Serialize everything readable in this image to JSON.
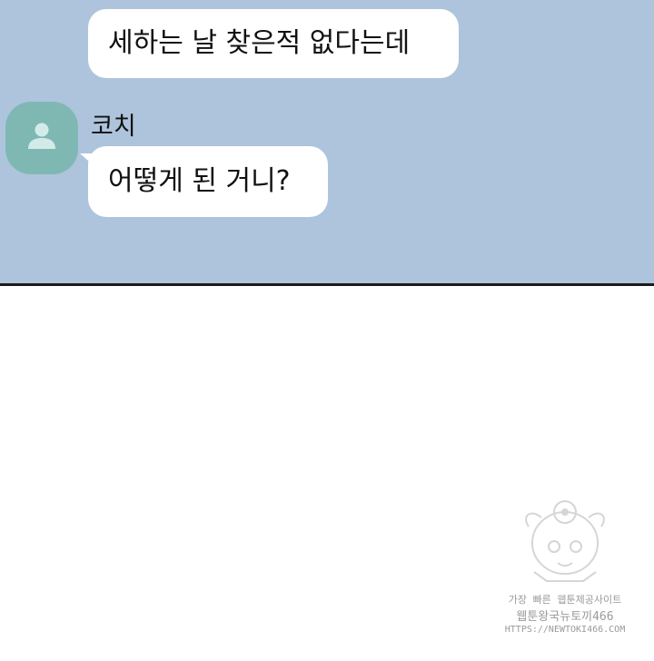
{
  "chat": {
    "messages": [
      {
        "text": "세하는 날 찾은적 없다는데"
      },
      {
        "sender": "코치",
        "text": "어떻게 된 거니?"
      }
    ]
  },
  "colors": {
    "chat_background": "#aec4dc",
    "bubble": "#ffffff",
    "avatar": "#7fb8b3",
    "divider": "#1b1b1b"
  },
  "icons": {
    "avatar": "person-icon"
  },
  "watermark": {
    "line1": "가장 빠른 웹툰제공사이트",
    "line2": "웹툰왕국뉴토끼466",
    "line3": "HTTPS://NEWTOKI466.COM"
  }
}
